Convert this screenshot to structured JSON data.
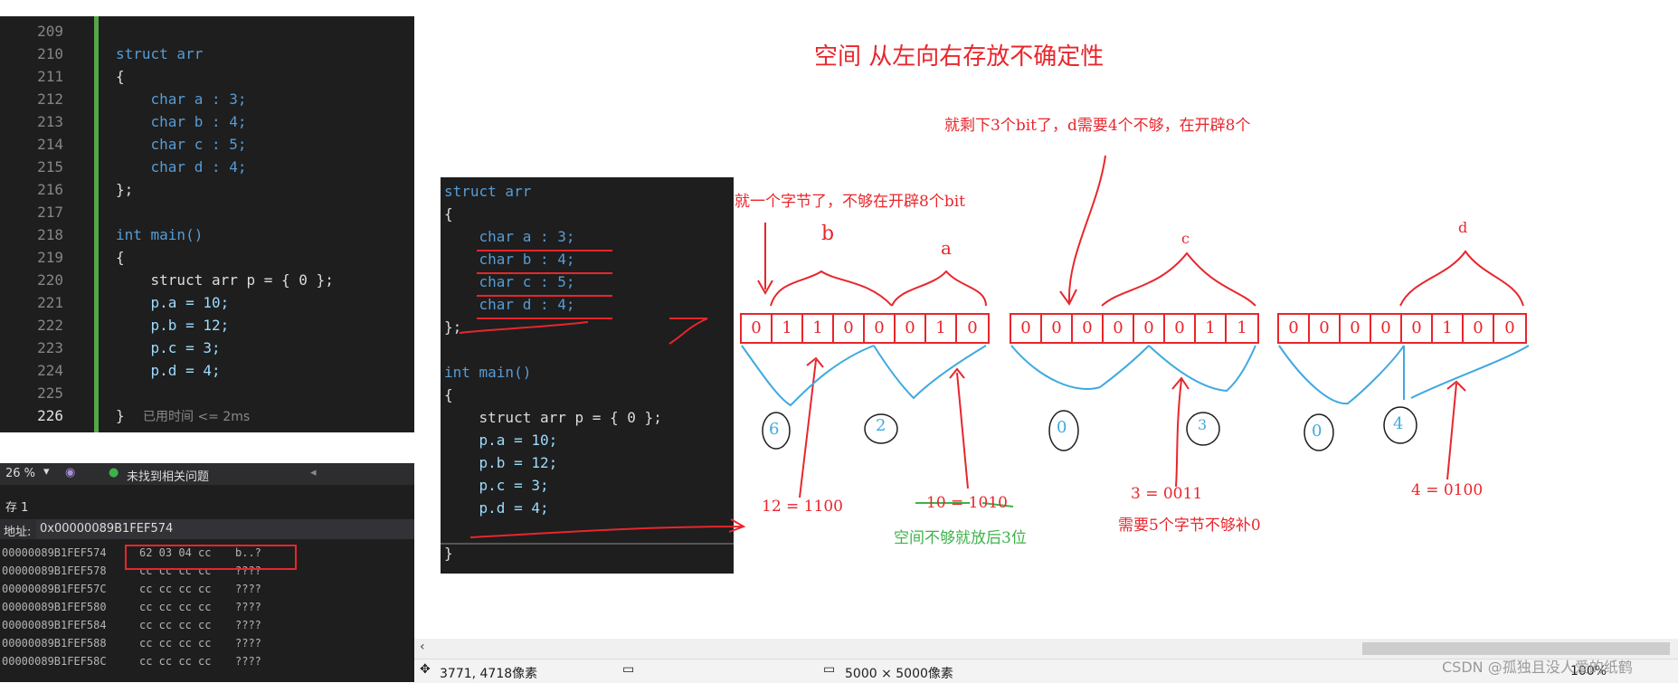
{
  "editor": {
    "lines": [
      {
        "no": "209",
        "code": ""
      },
      {
        "no": "210",
        "code": "struct arr"
      },
      {
        "no": "211",
        "code": "{"
      },
      {
        "no": "212",
        "code": "    char a : 3;"
      },
      {
        "no": "213",
        "code": "    char b : 4;"
      },
      {
        "no": "214",
        "code": "    char c : 5;"
      },
      {
        "no": "215",
        "code": "    char d : 4;"
      },
      {
        "no": "216",
        "code": "};"
      },
      {
        "no": "217",
        "code": ""
      },
      {
        "no": "218",
        "code": "int main()"
      },
      {
        "no": "219",
        "code": "{"
      },
      {
        "no": "220",
        "code": "    struct arr p = { 0 };"
      },
      {
        "no": "221",
        "code": "    p.a = 10;"
      },
      {
        "no": "222",
        "code": "    p.b = 12;"
      },
      {
        "no": "223",
        "code": "    p.c = 3;"
      },
      {
        "no": "224",
        "code": "    p.d = 4;"
      },
      {
        "no": "225",
        "code": ""
      },
      {
        "no": "226",
        "code": "}"
      }
    ],
    "elapsed_hint": "已用时间 <= 2ms"
  },
  "ide_toolbar": {
    "zoom": "26 %",
    "issues": "未找到相关问题"
  },
  "memory": {
    "title": "存 1",
    "address_label": "地址:",
    "address_value": "0x00000089B1FEF574",
    "rows": [
      {
        "addr": "00000089B1FEF574",
        "bytes": "62 03 04 cc",
        "ascii": "b..?"
      },
      {
        "addr": "00000089B1FEF578",
        "bytes": "cc cc cc cc",
        "ascii": "????"
      },
      {
        "addr": "00000089B1FEF57C",
        "bytes": "cc cc cc cc",
        "ascii": "????"
      },
      {
        "addr": "00000089B1FEF580",
        "bytes": "cc cc cc cc",
        "ascii": "????"
      },
      {
        "addr": "00000089B1FEF584",
        "bytes": "cc cc cc cc",
        "ascii": "????"
      },
      {
        "addr": "00000089B1FEF588",
        "bytes": "cc cc cc cc",
        "ascii": "????"
      },
      {
        "addr": "00000089B1FEF58C",
        "bytes": "cc cc cc cc",
        "ascii": "????"
      }
    ]
  },
  "snippet": {
    "lines": [
      "struct arr",
      "{",
      "    char a : 3;",
      "    char b : 4;",
      "    char c : 5;",
      "    char d : 4;",
      "};",
      "",
      "int main()",
      "{",
      "    struct arr p = { 0 };",
      "    p.a = 10;",
      "    p.b = 12;",
      "    p.c = 3;",
      "    p.d = 4;",
      "",
      "}"
    ]
  },
  "annotations": {
    "title": "空间 从左向右存放不确定性",
    "note_top": "就剩下3个bit了，d需要4个不够，在开辟8个",
    "note_left": "就一个字节了，不够在开辟8个bit",
    "label_b": "b",
    "label_a": "a",
    "label_c": "c",
    "label_d": "d",
    "byte1_bits": [
      "0",
      "1",
      "1",
      "0",
      "0",
      "0",
      "1",
      "0"
    ],
    "byte2_bits": [
      "0",
      "0",
      "0",
      "0",
      "0",
      "0",
      "1",
      "1"
    ],
    "byte3_bits": [
      "0",
      "0",
      "0",
      "0",
      "0",
      "1",
      "0",
      "0"
    ],
    "circ_6": "6",
    "circ_2": "2",
    "circ_0a": "0",
    "circ_3": "3",
    "circ_0b": "0",
    "circ_4": "4",
    "eq_12": "12 = 1100",
    "eq_10": "10 = 1010",
    "note_green": "空间不够就放后3位",
    "eq_3": "3 = 0011",
    "note_pad": "需要5个字节不够补0",
    "eq_4": "4 = 0100"
  },
  "statusbar": {
    "cursor_pos": "3771, 4718像素",
    "image_size": "5000 × 5000像素",
    "zoom": "100%",
    "watermark": "CSDN @孤独且没人爱的纸鹤"
  },
  "colors": {
    "ink_red": "#e8262c",
    "ink_blue": "#3fa9e0",
    "ink_green": "#3cb34a",
    "editor_bg": "#1e1e1e"
  }
}
